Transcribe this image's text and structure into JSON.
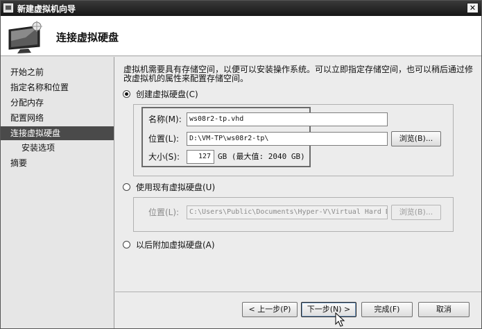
{
  "window": {
    "title": "新建虚拟机向导",
    "close_glyph": "✕"
  },
  "header": {
    "heading": "连接虚拟硬盘"
  },
  "nav": {
    "items": [
      {
        "label": "开始之前"
      },
      {
        "label": "指定名称和位置"
      },
      {
        "label": "分配内存"
      },
      {
        "label": "配置网络"
      },
      {
        "label": "连接虚拟硬盘"
      },
      {
        "label": "安装选项"
      },
      {
        "label": "摘要"
      }
    ],
    "active_index": 4
  },
  "content": {
    "description": "虚拟机需要具有存储空间，以便可以安装操作系统。可以立即指定存储空间，也可以稍后通过修改虚拟机的属性来配置存储空间。",
    "options": {
      "create": {
        "label": "创建虚拟硬盘(C)",
        "selected": true,
        "name_label": "名称(M):",
        "name_value": "ws08r2-tp.vhd",
        "location_label": "位置(L):",
        "location_value": "D:\\VM-TP\\ws08r2-tp\\",
        "browse_label": "浏览(B)...",
        "size_label": "大小(S):",
        "size_value": "127",
        "size_unit": "GB (最大值: 2040 GB)"
      },
      "existing": {
        "label": "使用现有虚拟硬盘(U)",
        "selected": false,
        "location_label": "位置(L):",
        "location_value": "C:\\Users\\Public\\Documents\\Hyper-V\\Virtual Hard D",
        "browse_label": "浏览(B)..."
      },
      "later": {
        "label": "以后附加虚拟硬盘(A)",
        "selected": false
      }
    }
  },
  "footer": {
    "previous_label": "< 上一步(P)",
    "next_label": "下一步(N) >",
    "finish_label": "完成(F)",
    "cancel_label": "取消"
  }
}
